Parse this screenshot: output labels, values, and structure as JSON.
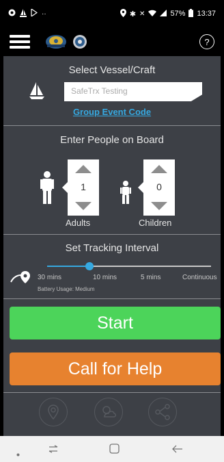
{
  "status_bar": {
    "battery": "57%",
    "time": "13:37"
  },
  "app_bar": {
    "menu_icon": "hamburger-icon",
    "help_label": "?"
  },
  "vessel": {
    "title": "Select Vessel/Craft",
    "input_placeholder": "SafeTrx Testing",
    "group_link": "Group Event Code"
  },
  "people": {
    "title": "Enter People on Board",
    "adults_value": "1",
    "adults_label": "Adults",
    "children_value": "0",
    "children_label": "Children"
  },
  "tracking": {
    "title": "Set Tracking Interval",
    "options": [
      "30 mins",
      "10 mins",
      "5 mins",
      "Continuous"
    ],
    "selected_index": 1,
    "battery_usage": "Battery Usage: Medium"
  },
  "actions": {
    "start_label": "Start",
    "help_label": "Call for Help"
  },
  "bottom_icons": [
    "location-pin-icon",
    "weather-icon",
    "share-icon"
  ],
  "nav": [
    "dot",
    "recents",
    "home",
    "back"
  ],
  "colors": {
    "accent": "#36a9e1",
    "start": "#4cd45a",
    "help": "#e7822f",
    "panel": "#3d4046"
  }
}
